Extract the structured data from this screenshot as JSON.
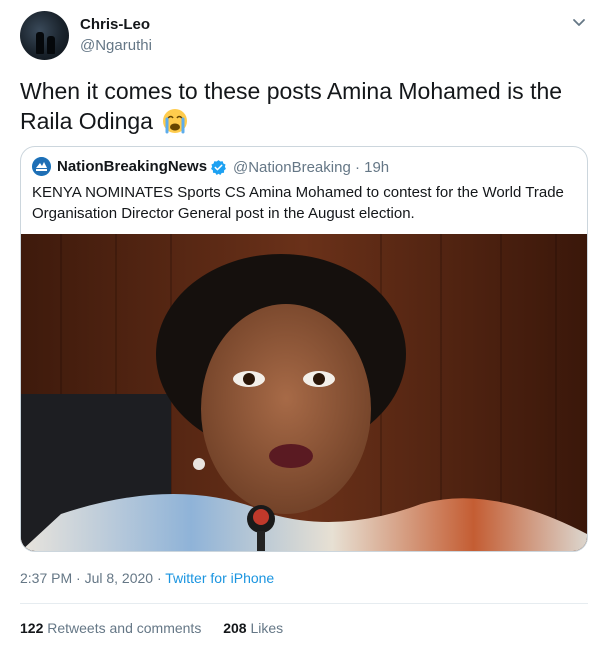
{
  "tweet": {
    "author_name": "Chris-Leo",
    "author_handle": "@Ngaruthi",
    "text": "When it comes to these posts Amina Mohamed is the Raila Odinga",
    "emoji_icon": "loudly-crying-face-icon",
    "timestamp": "2:37 PM · Jul 8, 2020 ·",
    "source": "Twitter for iPhone",
    "retweets_count": "122",
    "retweets_label": "Retweets and comments",
    "likes_count": "208",
    "likes_label": "Likes"
  },
  "quoted": {
    "author_name": "NationBreakingNews",
    "author_handle": "@NationBreaking · 19h",
    "text": "KENYA NOMINATES Sports CS Amina Mohamed to contest for the World Trade Organisation Director General post in the August election.",
    "verified_icon": "verified-badge-icon"
  },
  "colors": {
    "link": "#1b95e0",
    "secondary_text": "#657786",
    "verified": "#1da1f2",
    "border": "#ccd6dd"
  }
}
